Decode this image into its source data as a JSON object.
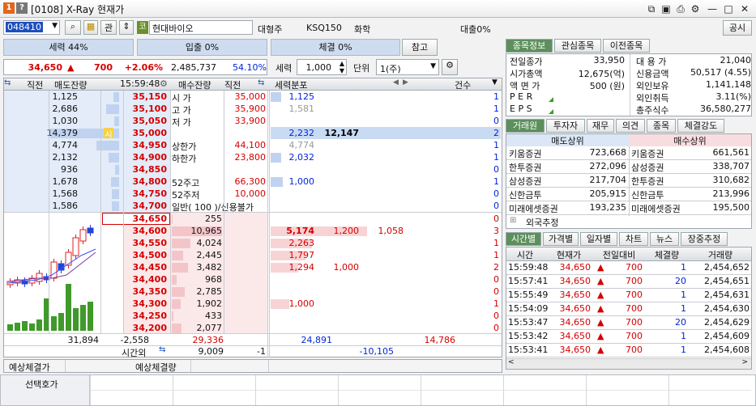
{
  "window": {
    "title": "[0108] X-Ray 현재가"
  },
  "toolbar": {
    "code": "048410",
    "btn_gwan": "관",
    "stock_icon": "코",
    "stock_name": "현대바이오",
    "major": "대형주",
    "index": "KSQ150",
    "sector": "화학",
    "loan": "대출0%",
    "notice_btn": "공시"
  },
  "buttons": {
    "sell_power": "세력 44%",
    "inflow": "입출 0%",
    "execution": "체결 0%",
    "reference": "참고"
  },
  "price": {
    "current": "34,650",
    "arrow": "▲",
    "change": "700",
    "rate": "+2.06%",
    "volume": "2,485,737",
    "ratio": "54.10%"
  },
  "controls": {
    "force_label": "세력",
    "force_value": "1,000",
    "unit_label": "단위",
    "unit_value": "1(주)"
  },
  "orderbook": {
    "headers": {
      "direct_l": "직전",
      "sell_rem": "매도잔량",
      "time": "15:59:48",
      "buy_rem": "매수잔량",
      "direct_r": "직전",
      "force_dist": "세력분포",
      "count": "건수"
    },
    "asks": [
      {
        "qty": "1,125",
        "price": "35,150",
        "info": "시 가",
        "info_val": "35,000",
        "force": "1,125",
        "fbar": 0.09,
        "cnt": "1"
      },
      {
        "qty": "2,686",
        "price": "35,100",
        "info": "고 가",
        "info_val": "35,900",
        "force": "1,581",
        "fbar": 0.0,
        "cnt": "1",
        "fgray": true
      },
      {
        "qty": "1,030",
        "price": "35,050",
        "info": "저 가",
        "info_val": "33,900",
        "force": "",
        "fbar": 0.0,
        "cnt": "0"
      },
      {
        "qty": "14,379",
        "price": "35,000",
        "info": "",
        "info_val": "",
        "force": "2,232",
        "force2": "12,147",
        "fbar": 0.0,
        "cnt": "2",
        "hl": true
      },
      {
        "qty": "4,774",
        "price": "34,950",
        "info": "상한가",
        "info_val": "44,100",
        "force": "4,774",
        "fbar": 0.0,
        "cnt": "1",
        "fgray": true
      },
      {
        "qty": "2,132",
        "price": "34,900",
        "info": "하한가",
        "info_val": "23,800",
        "force": "2,032",
        "fbar": 0.09,
        "cnt": "1"
      },
      {
        "qty": "936",
        "price": "34,850",
        "info": "",
        "info_val": "",
        "force": "",
        "fbar": 0.0,
        "cnt": "0"
      },
      {
        "qty": "1,678",
        "price": "34,800",
        "info": "52주고",
        "info_val": "66,300",
        "force": "1,000",
        "fbar": 0.11,
        "cnt": "1"
      },
      {
        "qty": "1,568",
        "price": "34,750",
        "info": "52주저",
        "info_val": "10,000",
        "force": "",
        "fbar": 0.0,
        "cnt": "0"
      },
      {
        "qty": "1,586",
        "price": "34,700",
        "info": "일반( 100 )/신용불가",
        "info_val": "",
        "force": "",
        "fbar": 0.0,
        "cnt": "0"
      }
    ],
    "ask_bars": [
      0.08,
      0.19,
      0.07,
      1.0,
      0.33,
      0.15,
      0.06,
      0.12,
      0.11,
      0.11
    ],
    "sise_marker": "시",
    "bids": [
      {
        "price": "34,650",
        "qty": "255",
        "force": "",
        "f2": "",
        "f3": "",
        "cnt": "0"
      },
      {
        "price": "34,600",
        "qty": "10,965",
        "force": "5,174",
        "f2": "1,200",
        "f3": "1,058",
        "cnt": "3"
      },
      {
        "price": "34,550",
        "qty": "4,024",
        "force": "2,263",
        "f2": "",
        "f3": "",
        "cnt": "1"
      },
      {
        "price": "34,500",
        "qty": "2,445",
        "force": "1,797",
        "f2": "",
        "f3": "",
        "cnt": "1"
      },
      {
        "price": "34,450",
        "qty": "3,482",
        "force": "1,294",
        "f2": "1,000",
        "f3": "",
        "cnt": "2"
      },
      {
        "price": "34,400",
        "qty": "968",
        "force": "",
        "f2": "",
        "f3": "",
        "cnt": "0"
      },
      {
        "price": "34,350",
        "qty": "2,785",
        "force": "",
        "f2": "",
        "f3": "",
        "cnt": "0"
      },
      {
        "price": "34,300",
        "qty": "1,902",
        "force": "1,000",
        "f2": "",
        "f3": "",
        "cnt": "1"
      },
      {
        "price": "34,250",
        "qty": "433",
        "force": "",
        "f2": "",
        "f3": "",
        "cnt": "0"
      },
      {
        "price": "34,200",
        "qty": "2,077",
        "force": "",
        "f2": "",
        "f3": "",
        "cnt": "0"
      }
    ],
    "bid_bars": [
      0.02,
      1.0,
      0.37,
      0.22,
      0.32,
      0.09,
      0.25,
      0.17,
      0.04,
      0.19
    ],
    "bid_force_bars": [
      0,
      0.42,
      0.18,
      0.15,
      0.12,
      0,
      0,
      0.08,
      0,
      0
    ],
    "totals": {
      "sell_total": "31,894",
      "diff": "-2,558",
      "buy_total": "29,336",
      "force_sell": "24,891",
      "force_buy": "14,786"
    },
    "after": {
      "label": "시간외",
      "buy": "9,009",
      "direct": "-1",
      "force": "-10,105"
    },
    "expected_price": "예상체결가",
    "expected_vol": "예상체결량"
  },
  "info_tabs": [
    "종목정보",
    "관심종목",
    "이전종목"
  ],
  "info": {
    "left": [
      [
        "전일종가",
        "33,950"
      ],
      [
        "시가총액",
        "12,675(억)"
      ],
      [
        "액 면 가",
        "500 (원)"
      ],
      [
        "P E R",
        ""
      ],
      [
        "E P S",
        ""
      ]
    ],
    "right": [
      [
        "대 용 가",
        "21,040"
      ],
      [
        "신용금액",
        "50,517  (4.55)"
      ],
      [
        "외인보유",
        "1,141,148"
      ],
      [
        "외인취득",
        "3.11(%)"
      ],
      [
        "총주식수",
        "36,580,277"
      ]
    ]
  },
  "broker_tabs": [
    "거래원",
    "투자자",
    "재무",
    "의견",
    "종목",
    "체결강도"
  ],
  "broker": {
    "sell_title": "매도상위",
    "buy_title": "매수상위",
    "rows": [
      [
        "키움증권",
        "723,668",
        "키움증권",
        "661,561"
      ],
      [
        "한투증권",
        "272,096",
        "삼성증권",
        "338,707"
      ],
      [
        "삼성증권",
        "217,704",
        "한투증권",
        "310,682"
      ],
      [
        "신한금투",
        "205,915",
        "신한금투",
        "213,996"
      ],
      [
        "미래에셋증권",
        "193,235",
        "미래에셋증권",
        "195,500"
      ]
    ],
    "foreign": "외국추정"
  },
  "trade_tabs": [
    "시간별",
    "가격별",
    "일자별",
    "차트",
    "뉴스",
    "장중추정"
  ],
  "trades": {
    "headers": [
      "시간",
      "현재가",
      "전일대비",
      "체결량",
      "거래량"
    ],
    "rows": [
      [
        "15:59:48",
        "34,650",
        "700",
        "1",
        "2,454,652"
      ],
      [
        "15:57:41",
        "34,650",
        "700",
        "20",
        "2,454,651"
      ],
      [
        "15:55:49",
        "34,650",
        "700",
        "1",
        "2,454,631"
      ],
      [
        "15:54:09",
        "34,650",
        "700",
        "1",
        "2,454,630"
      ],
      [
        "15:53:47",
        "34,650",
        "700",
        "20",
        "2,454,629"
      ],
      [
        "15:53:42",
        "34,650",
        "700",
        "1",
        "2,454,609"
      ],
      [
        "15:53:41",
        "34,650",
        "700",
        "1",
        "2,454,608"
      ]
    ]
  },
  "bottom": {
    "select_hoga": "선택호가"
  },
  "colors": {
    "ask_bg": "#e3ecf8",
    "bid_bg": "#fbe9ea",
    "ask_bar": "#bfd3f1",
    "bid_bar": "#f3c5c8",
    "tab_active": "#5c8f5c"
  }
}
